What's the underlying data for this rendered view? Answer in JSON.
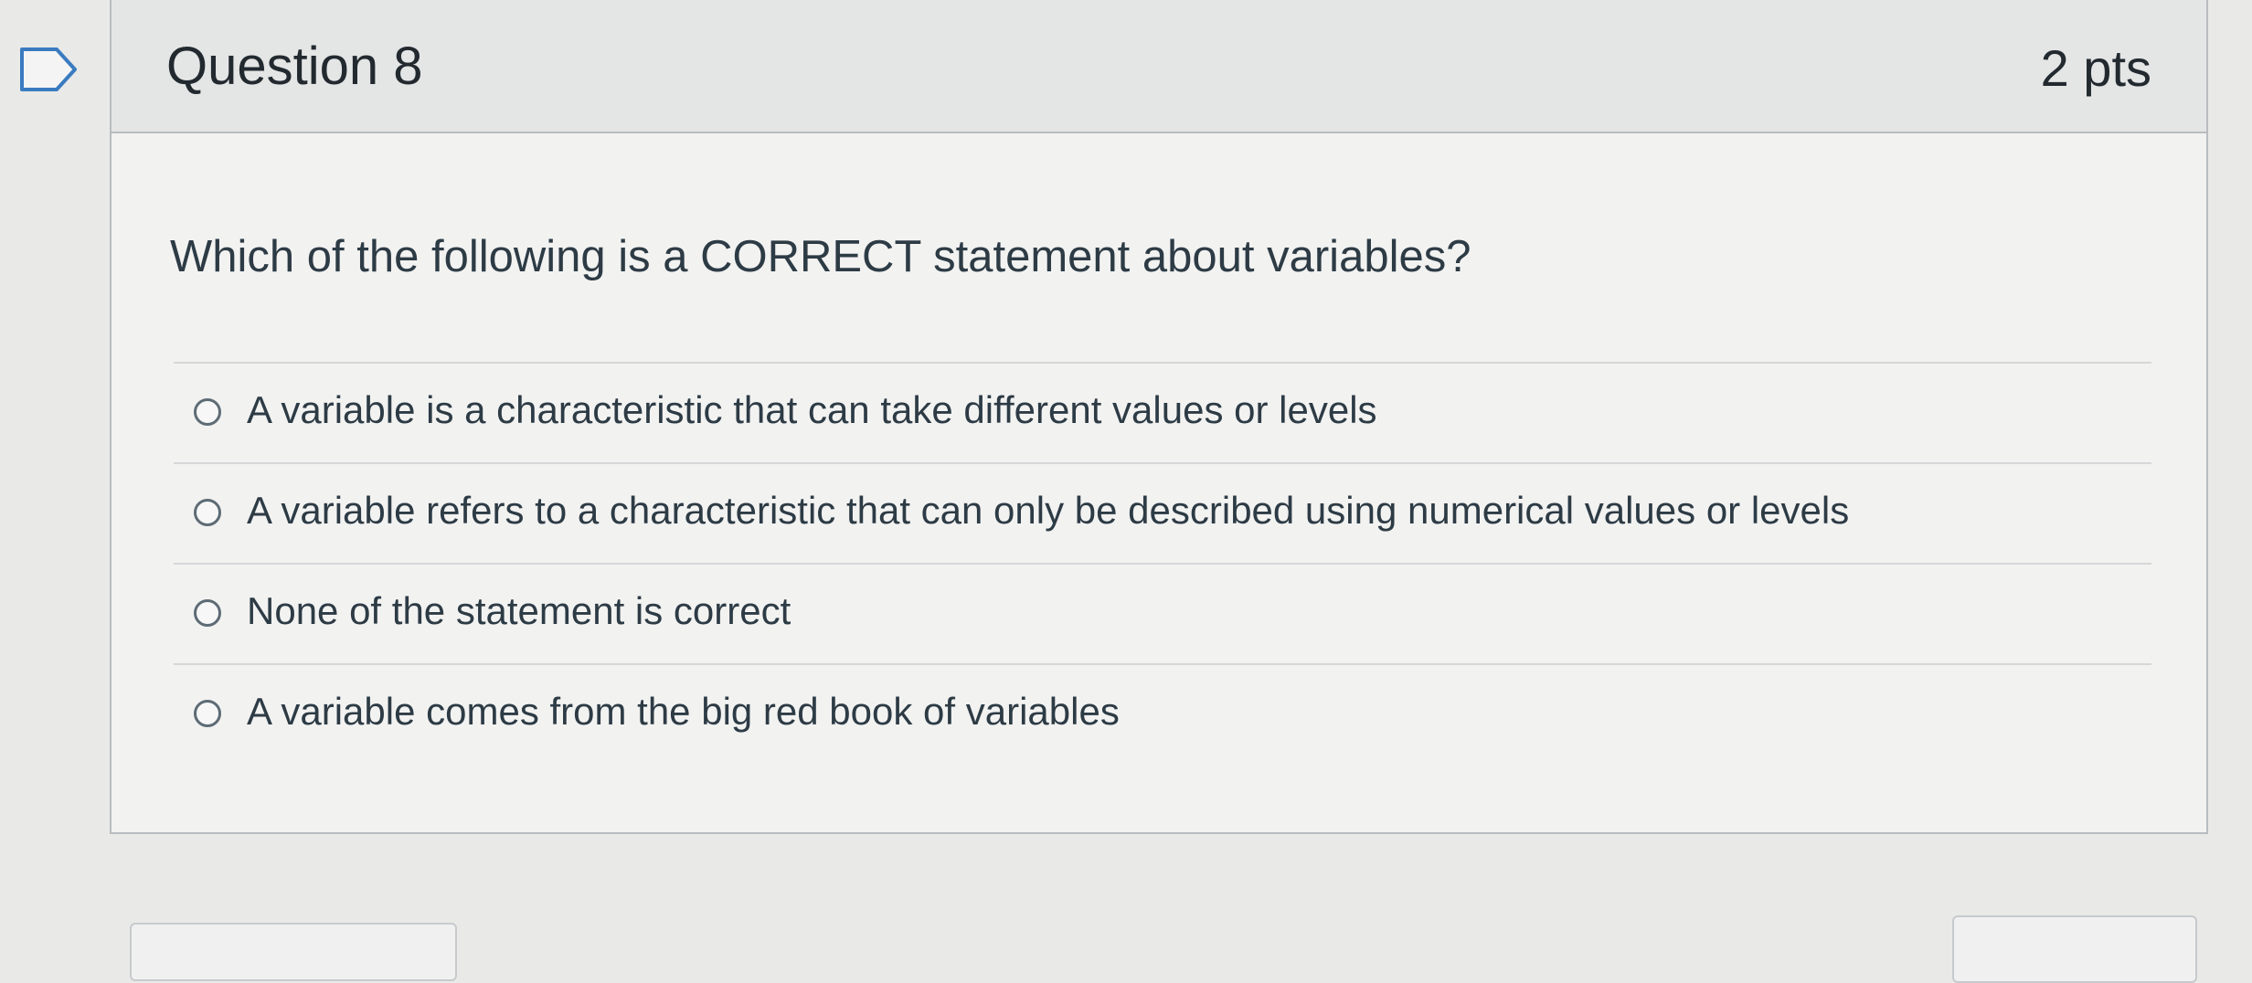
{
  "question": {
    "title": "Question 8",
    "points": "2 pts",
    "text": "Which of the following is a CORRECT statement about variables?",
    "answers": [
      {
        "label": "A variable is a characteristic that can take different values or levels",
        "selected": false
      },
      {
        "label": "A variable refers to a characteristic that can only be described using numerical values or levels",
        "selected": false
      },
      {
        "label": "None of the statement is correct",
        "selected": false
      },
      {
        "label": "A variable comes from the big red book of variables",
        "selected": false
      }
    ]
  },
  "icons": {
    "flag": "bookmark-flag-icon"
  },
  "colors": {
    "header_bg": "#e4e5e5",
    "card_bg": "#f2f2f1",
    "text": "#2d3b45",
    "border": "#b8bcbf"
  }
}
